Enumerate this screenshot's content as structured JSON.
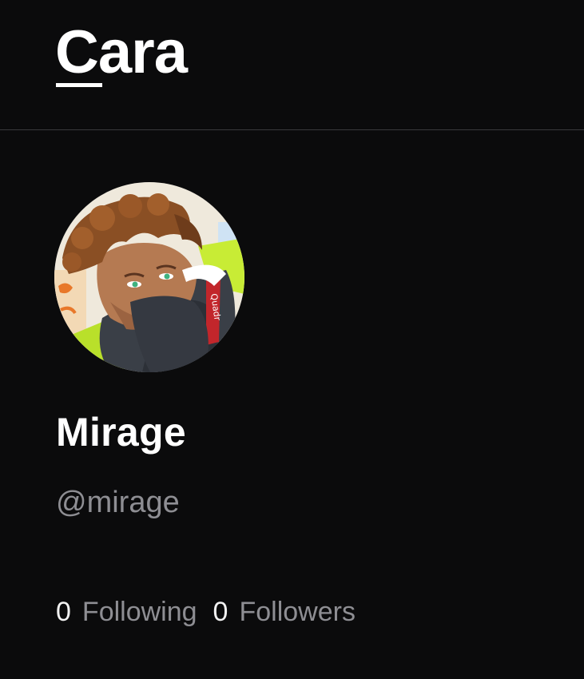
{
  "header": {
    "logo_text": "Cara"
  },
  "profile": {
    "avatar_icon": "user-avatar-illustration",
    "display_name": "Mirage",
    "handle": "@mirage",
    "stats": {
      "following_count": "0",
      "following_label": "Following",
      "followers_count": "0",
      "followers_label": "Followers"
    }
  },
  "colors": {
    "background": "#0b0b0c",
    "divider": "#3a3a3c",
    "text_primary": "#ffffff",
    "text_secondary": "#8e8e93"
  }
}
